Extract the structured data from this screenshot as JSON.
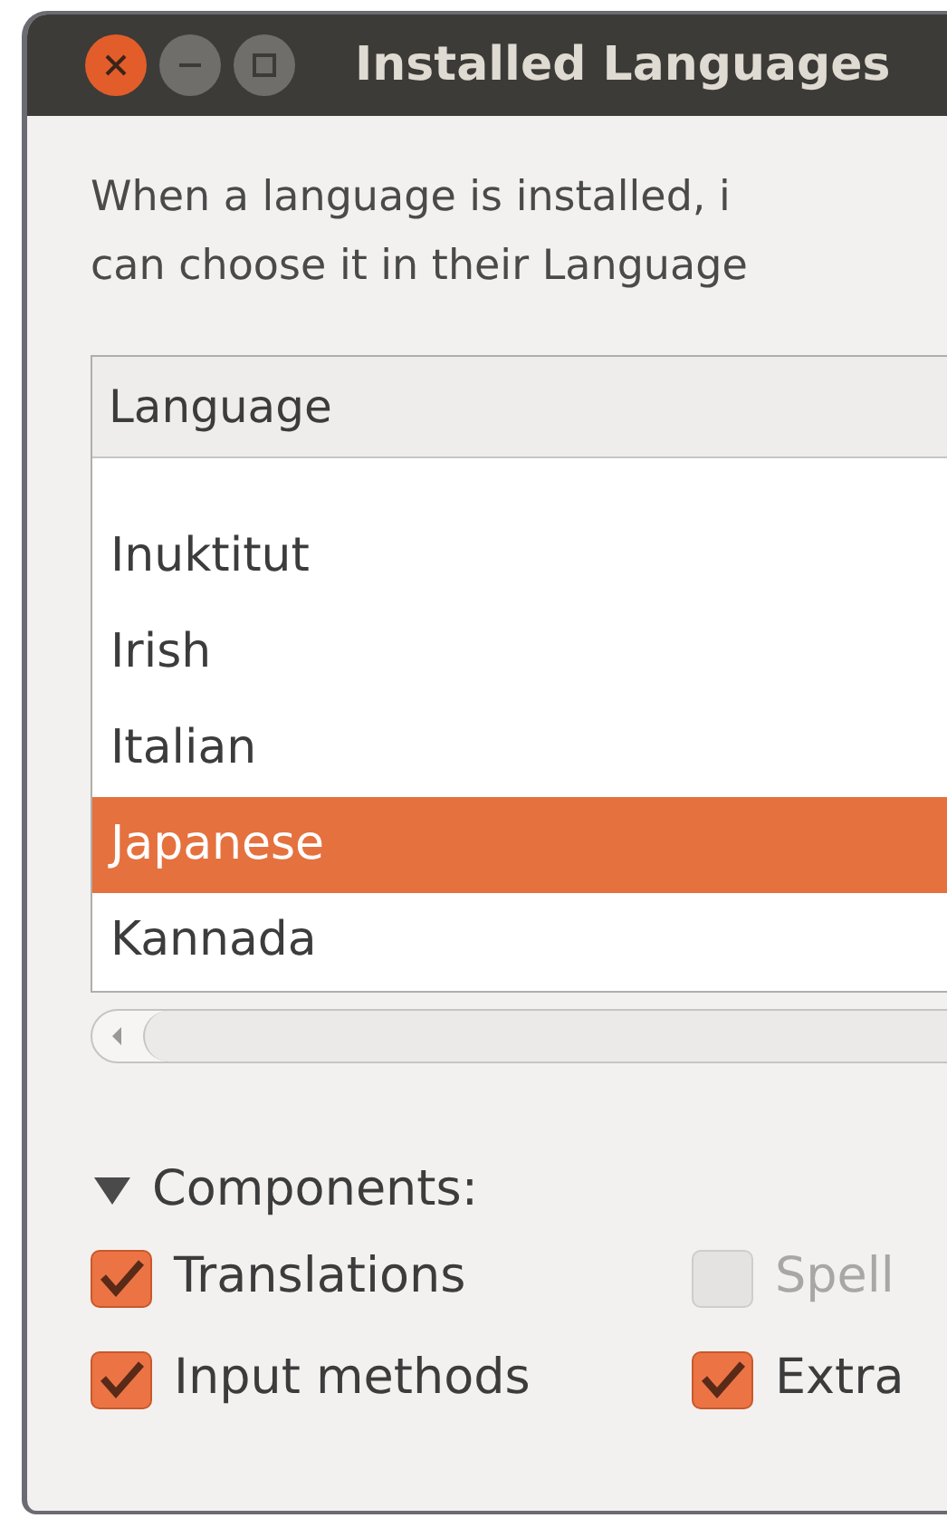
{
  "window": {
    "title": "Installed Languages"
  },
  "description": [
    "When a language is installed, i",
    "can choose it in their Language"
  ],
  "list": {
    "column": "Language",
    "rows": [
      {
        "label": "Inuktitut",
        "selected": false
      },
      {
        "label": "Irish",
        "selected": false
      },
      {
        "label": "Italian",
        "selected": false
      },
      {
        "label": "Japanese",
        "selected": true
      },
      {
        "label": "Kannada",
        "selected": false
      }
    ]
  },
  "components": {
    "label": "Components:",
    "expanded": true,
    "options": [
      {
        "label": "Translations",
        "checked": true,
        "disabled": false
      },
      {
        "label": "Spell",
        "checked": false,
        "disabled": true
      },
      {
        "label": "Input methods",
        "checked": true,
        "disabled": false
      },
      {
        "label": "Extra",
        "checked": true,
        "disabled": false
      }
    ]
  }
}
